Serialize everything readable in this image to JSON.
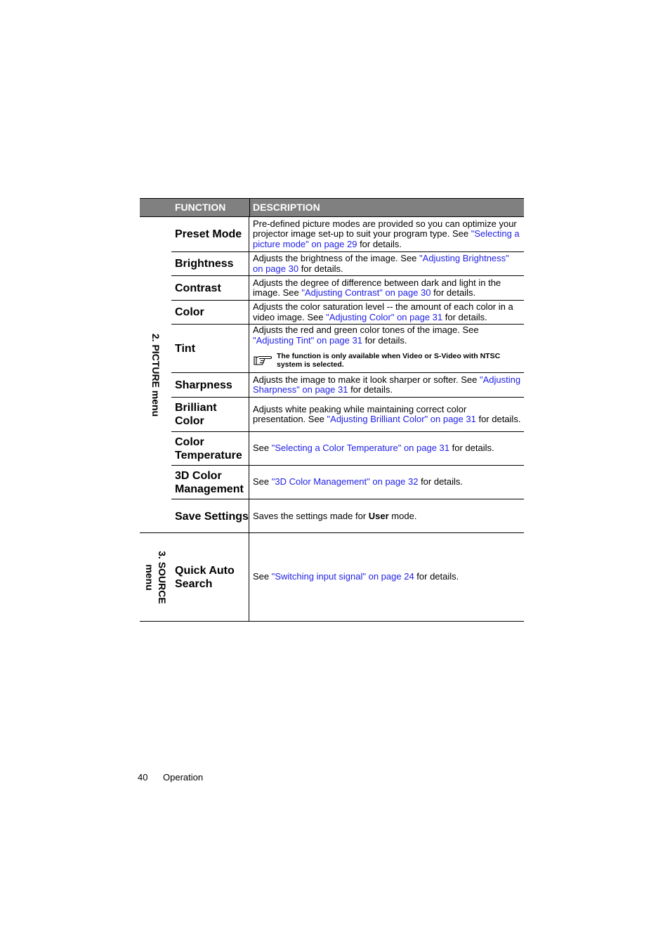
{
  "table": {
    "headers": {
      "function": "FUNCTION",
      "description": "DESCRIPTION"
    },
    "groups": [
      {
        "category": "2. PICTURE menu",
        "rows": [
          {
            "function": "Preset Mode",
            "text_before": "Pre-defined picture modes are provided so you can optimize your projector image set-up to suit your program type. See ",
            "link": "\"Selecting a picture mode\" on page 29",
            "text_after": " for details."
          },
          {
            "function": "Brightness",
            "text_before": "Adjusts the brightness of the image. See ",
            "link": "\"Adjusting Brightness\" on page 30",
            "text_after": " for details."
          },
          {
            "function": "Contrast",
            "text_before": "Adjusts the degree of difference between dark and light in the image. See ",
            "link": "\"Adjusting Contrast\" on page 30",
            "text_after": " for details."
          },
          {
            "function": "Color",
            "text_before": "Adjusts the color saturation level -- the amount of each color in a video image. See ",
            "link": "\"Adjusting Color\" on page 31",
            "text_after": " for details."
          },
          {
            "function": "Tint",
            "text_before": "Adjusts the red and green color tones of the image. See ",
            "link": "\"Adjusting Tint\" on page 31",
            "text_after": " for details.",
            "note": "The function is only available when Video or S-Video with NTSC system is selected.",
            "note_icon": "pointing-hand-icon"
          },
          {
            "function": "Sharpness",
            "text_before": "Adjusts the image to make it look sharper or softer. See ",
            "link": "\"Adjusting Sharpness\" on page 31",
            "text_after": " for details."
          },
          {
            "function": "Brilliant Color",
            "text_before": "Adjusts white peaking while maintaining correct color presentation. See ",
            "link": "\"Adjusting Brilliant Color\" on page 31",
            "text_after": " for details."
          },
          {
            "function": "Color Temperature",
            "text_before": "See ",
            "link": "\"Selecting a Color Temperature\" on page 31",
            "text_after": " for details."
          },
          {
            "function": "3D Color Management",
            "text_before": "See ",
            "link": "\"3D Color Management\" on page 32",
            "text_after": " for details."
          },
          {
            "function": "Save Settings",
            "text_before": "Saves the settings made for ",
            "bold": "User",
            "text_after": " mode."
          }
        ]
      },
      {
        "category_line1": "3. SOURCE",
        "category_line2": "menu",
        "rows": [
          {
            "function": "Quick Auto Search",
            "text_before": "See ",
            "link": "\"Switching input signal\" on page 24",
            "text_after": " for details."
          }
        ]
      }
    ]
  },
  "footer": {
    "page_number": "40",
    "section": "Operation"
  },
  "colors": {
    "header_bg": "#808080",
    "header_text": "#ffffff",
    "link": "#1f1fe6"
  }
}
